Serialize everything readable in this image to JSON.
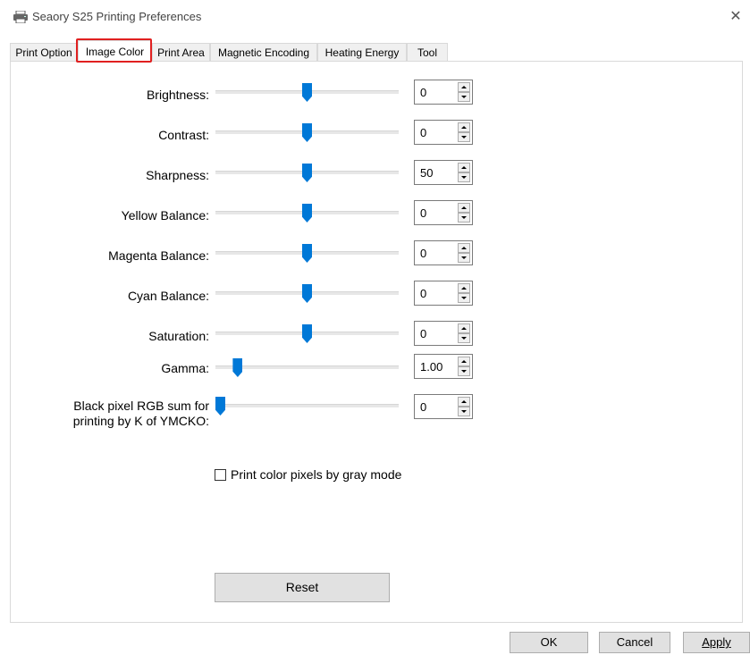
{
  "window": {
    "title": "Seaory S25 Printing Preferences",
    "close_symbol": "✕"
  },
  "tabs": [
    {
      "label": "Print Option",
      "active": false
    },
    {
      "label": "Image Color",
      "active": true
    },
    {
      "label": "Print Area",
      "active": false
    },
    {
      "label": "Magnetic Encoding",
      "active": false
    },
    {
      "label": "Heating Energy",
      "active": false
    },
    {
      "label": "Tool",
      "active": false
    }
  ],
  "sliders": [
    {
      "label": "Brightness:",
      "value": "0",
      "position": 0.5
    },
    {
      "label": "Contrast:",
      "value": "0",
      "position": 0.5
    },
    {
      "label": "Sharpness:",
      "value": "50",
      "position": 0.5
    },
    {
      "label": "Yellow Balance:",
      "value": "0",
      "position": 0.5
    },
    {
      "label": "Magenta Balance:",
      "value": "0",
      "position": 0.5
    },
    {
      "label": "Cyan Balance:",
      "value": "0",
      "position": 0.5
    },
    {
      "label": "Saturation:",
      "value": "0",
      "position": 0.5
    },
    {
      "label": "Gamma:",
      "value": "1.00",
      "position": 0.1
    },
    {
      "label_line1": "Black pixel RGB sum for",
      "label_line2": "printing by K of YMCKO:",
      "value": "0",
      "position": 0.0
    }
  ],
  "gray_mode": {
    "label": "Print color pixels by gray mode",
    "checked": false
  },
  "buttons": {
    "reset": "Reset",
    "ok": "OK",
    "cancel": "Cancel",
    "apply": "Apply"
  },
  "colors": {
    "accent": "#0078d7",
    "highlight": "#e02020"
  },
  "icons": {
    "title": "printer-icon"
  }
}
